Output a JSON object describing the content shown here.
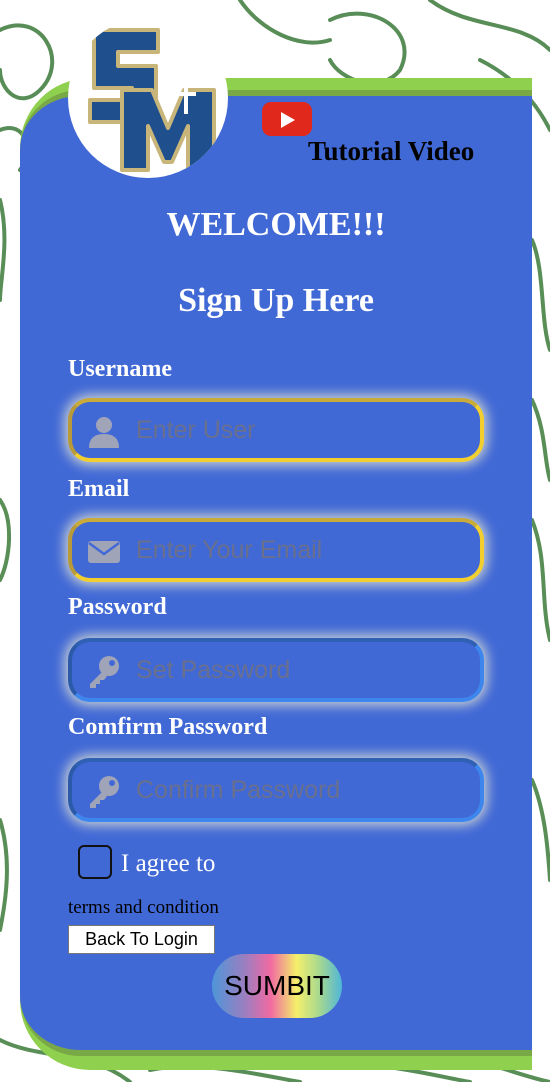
{
  "header": {
    "tutorial_label": "Tutorial Video",
    "logo_icon": "sm-school-logo",
    "video_icon": "youtube-icon"
  },
  "form": {
    "welcome": "WELCOME!!!",
    "title": "Sign Up Here",
    "username": {
      "label": "Username",
      "placeholder": "Enter User",
      "icon": "user-icon"
    },
    "email": {
      "label": "Email",
      "placeholder": "Enter Your Email",
      "icon": "envelope-icon"
    },
    "password": {
      "label": "Password",
      "placeholder": "Set Password",
      "icon": "key-icon"
    },
    "confirm": {
      "label": "Comfirm Password",
      "placeholder": "Confirm Password",
      "icon": "key-icon"
    },
    "agree_label": "I agree to",
    "terms_text": "terms and condition",
    "back_label": "Back To Login",
    "submit_label": "SUMBIT"
  },
  "colors": {
    "card": "#4169d6",
    "card_border": "#8fd14f",
    "field_border_gold": "#f2cf2f",
    "field_border_blue": "#3d86ee",
    "youtube_red": "#e0281c",
    "logo_navy": "#1f4f8c",
    "logo_gold": "#c8b57a"
  }
}
